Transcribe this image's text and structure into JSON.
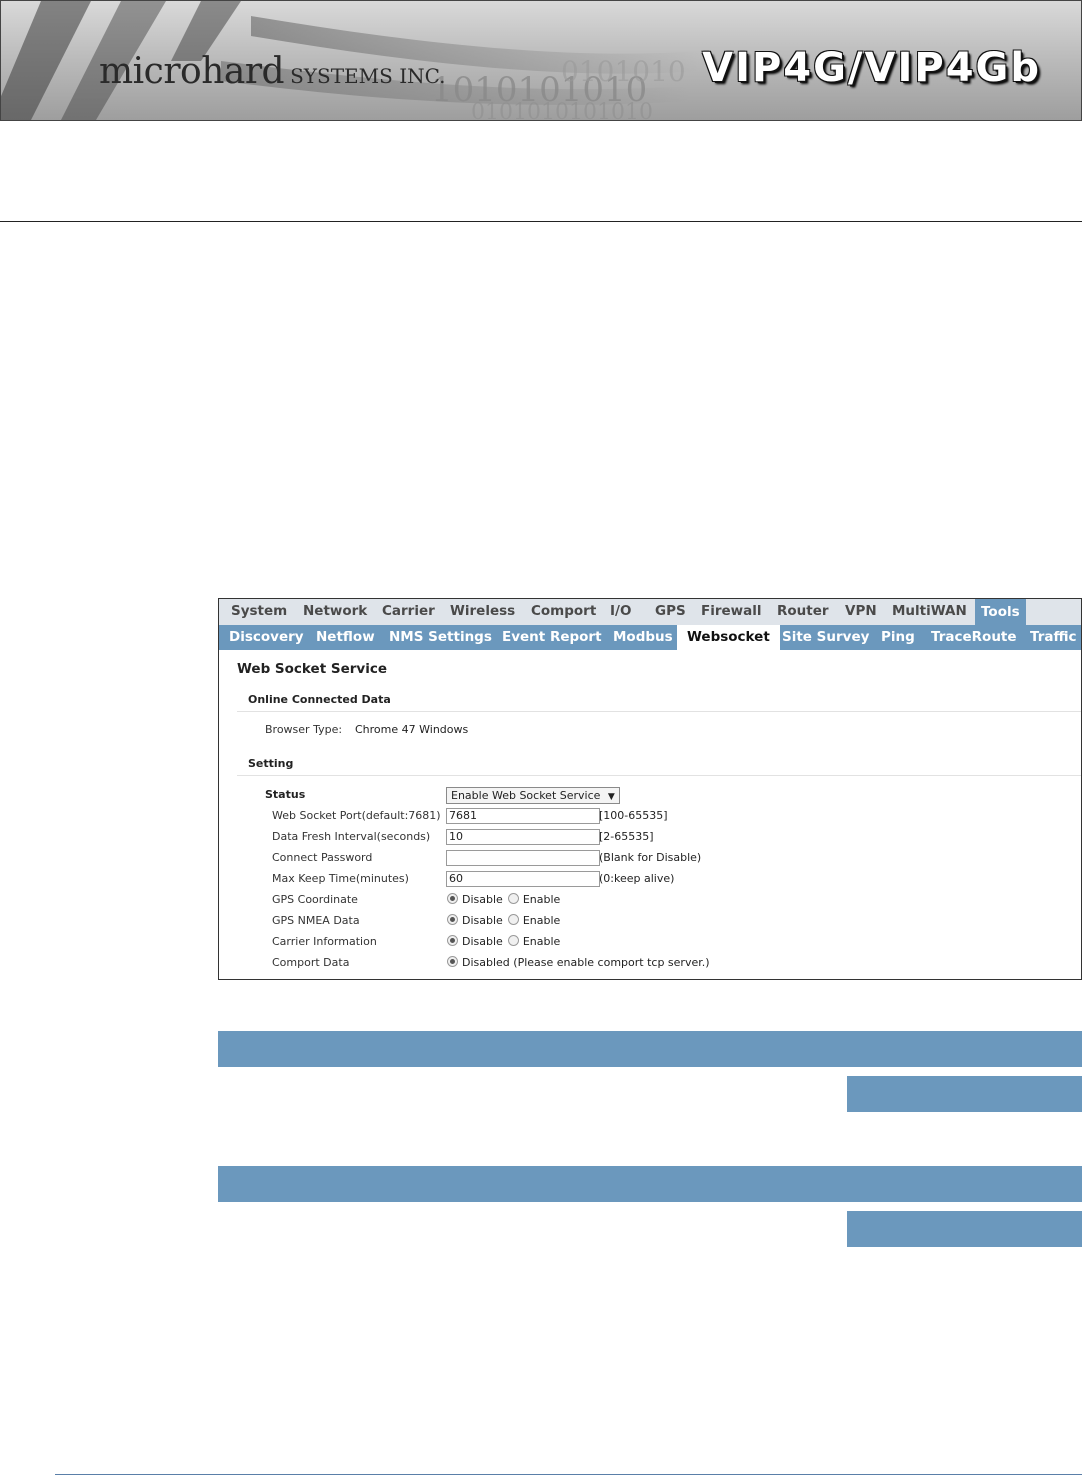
{
  "header": {
    "company_main": "microhard",
    "company_suffix": "SYSTEMS INC.",
    "product": "VIP4G/VIP4Gb",
    "binary_decor": "0101010101010101"
  },
  "colors": {
    "nav_accent": "#6b98bd",
    "nav_top_bg": "#dfe4ea",
    "bar_blue": "#6b98bd"
  },
  "nav": {
    "top_tabs": [
      "System",
      "Network",
      "Carrier",
      "Wireless",
      "Comport",
      "I/O",
      "GPS",
      "Firewall",
      "Router",
      "VPN",
      "MultiWAN",
      "Tools"
    ],
    "top_active": "Tools",
    "sub_tabs": [
      "Discovery",
      "Netflow",
      "NMS Settings",
      "Event Report",
      "Modbus",
      "Websocket",
      "Site Survey",
      "Ping",
      "TraceRoute",
      "Traffic"
    ],
    "sub_active": "Websocket"
  },
  "page": {
    "title": "Web Socket Service",
    "online_section": "Online Connected Data",
    "browser_type_label": "Browser Type:",
    "browser_type_value": "Chrome 47 Windows",
    "setting_section": "Setting"
  },
  "settings": {
    "status_label": "Status",
    "status_value": "Enable Web Socket Service",
    "port_label": "Web Socket Port(default:7681)",
    "port_value": "7681",
    "port_hint": "[100-65535]",
    "interval_label": "Data Fresh Interval(seconds)",
    "interval_value": "10",
    "interval_hint": "[2-65535]",
    "password_label": "Connect Password",
    "password_value": "",
    "password_hint": "(Blank for Disable)",
    "keep_label": "Max Keep Time(minutes)",
    "keep_value": "60",
    "keep_hint": "(0:keep alive)",
    "gps_coord_label": "GPS Coordinate",
    "gps_nmea_label": "GPS NMEA Data",
    "carrier_label": "Carrier Information",
    "comport_label": "Comport Data",
    "disable": "Disable",
    "enable": "Enable",
    "comport_disabled": "Disabled (Please enable comport tcp server.)"
  }
}
